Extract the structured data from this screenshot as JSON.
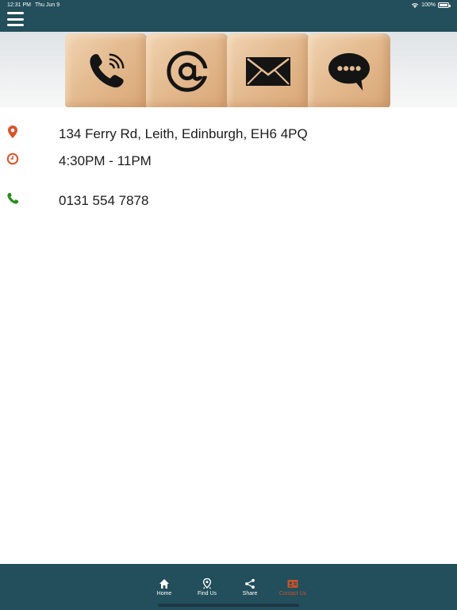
{
  "status_bar": {
    "time": "12:31 PM",
    "date": "Thu Jun 9",
    "battery": "100%"
  },
  "header": {
    "menu_icon": "hamburger-menu-icon"
  },
  "banner": {
    "cubes": [
      "phone-icon",
      "at-sign-icon",
      "envelope-icon",
      "chat-bubble-icon"
    ]
  },
  "contact": {
    "address": "134 Ferry Rd, Leith, Edinburgh, EH6 4PQ",
    "hours": "4:30PM - 11PM",
    "phone": "0131 554 7878"
  },
  "tabs": [
    {
      "label": "Home",
      "icon": "home-icon"
    },
    {
      "label": "Find Us",
      "icon": "map-pin-icon"
    },
    {
      "label": "Share",
      "icon": "share-icon"
    },
    {
      "label": "Contact Us",
      "icon": "contact-card-icon",
      "active": true
    }
  ],
  "colors": {
    "header_bg": "#234e5b",
    "accent_orange": "#d9542a",
    "phone_green": "#2e8b23",
    "active_tab": "#c7532a"
  }
}
